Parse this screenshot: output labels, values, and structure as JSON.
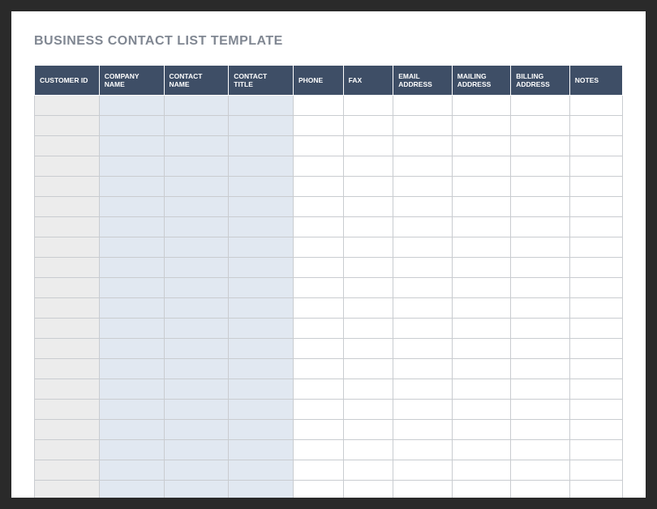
{
  "title": "BUSINESS CONTACT LIST TEMPLATE",
  "columns": [
    {
      "label": "CUSTOMER ID",
      "style": "id"
    },
    {
      "label": "COMPANY NAME",
      "style": "shaded"
    },
    {
      "label": "CONTACT NAME",
      "style": "shaded"
    },
    {
      "label": "CONTACT TITLE",
      "style": "shaded"
    },
    {
      "label": "PHONE",
      "style": "white"
    },
    {
      "label": "FAX",
      "style": "white"
    },
    {
      "label": "EMAIL ADDRESS",
      "style": "white"
    },
    {
      "label": "MAILING ADDRESS",
      "style": "white"
    },
    {
      "label": "BILLING ADDRESS",
      "style": "white"
    },
    {
      "label": "NOTES",
      "style": "white"
    }
  ],
  "rows": [
    [
      "",
      "",
      "",
      "",
      "",
      "",
      "",
      "",
      "",
      ""
    ],
    [
      "",
      "",
      "",
      "",
      "",
      "",
      "",
      "",
      "",
      ""
    ],
    [
      "",
      "",
      "",
      "",
      "",
      "",
      "",
      "",
      "",
      ""
    ],
    [
      "",
      "",
      "",
      "",
      "",
      "",
      "",
      "",
      "",
      ""
    ],
    [
      "",
      "",
      "",
      "",
      "",
      "",
      "",
      "",
      "",
      ""
    ],
    [
      "",
      "",
      "",
      "",
      "",
      "",
      "",
      "",
      "",
      ""
    ],
    [
      "",
      "",
      "",
      "",
      "",
      "",
      "",
      "",
      "",
      ""
    ],
    [
      "",
      "",
      "",
      "",
      "",
      "",
      "",
      "",
      "",
      ""
    ],
    [
      "",
      "",
      "",
      "",
      "",
      "",
      "",
      "",
      "",
      ""
    ],
    [
      "",
      "",
      "",
      "",
      "",
      "",
      "",
      "",
      "",
      ""
    ],
    [
      "",
      "",
      "",
      "",
      "",
      "",
      "",
      "",
      "",
      ""
    ],
    [
      "",
      "",
      "",
      "",
      "",
      "",
      "",
      "",
      "",
      ""
    ],
    [
      "",
      "",
      "",
      "",
      "",
      "",
      "",
      "",
      "",
      ""
    ],
    [
      "",
      "",
      "",
      "",
      "",
      "",
      "",
      "",
      "",
      ""
    ],
    [
      "",
      "",
      "",
      "",
      "",
      "",
      "",
      "",
      "",
      ""
    ],
    [
      "",
      "",
      "",
      "",
      "",
      "",
      "",
      "",
      "",
      ""
    ],
    [
      "",
      "",
      "",
      "",
      "",
      "",
      "",
      "",
      "",
      ""
    ],
    [
      "",
      "",
      "",
      "",
      "",
      "",
      "",
      "",
      "",
      ""
    ],
    [
      "",
      "",
      "",
      "",
      "",
      "",
      "",
      "",
      "",
      ""
    ],
    [
      "",
      "",
      "",
      "",
      "",
      "",
      "",
      "",
      "",
      ""
    ]
  ]
}
